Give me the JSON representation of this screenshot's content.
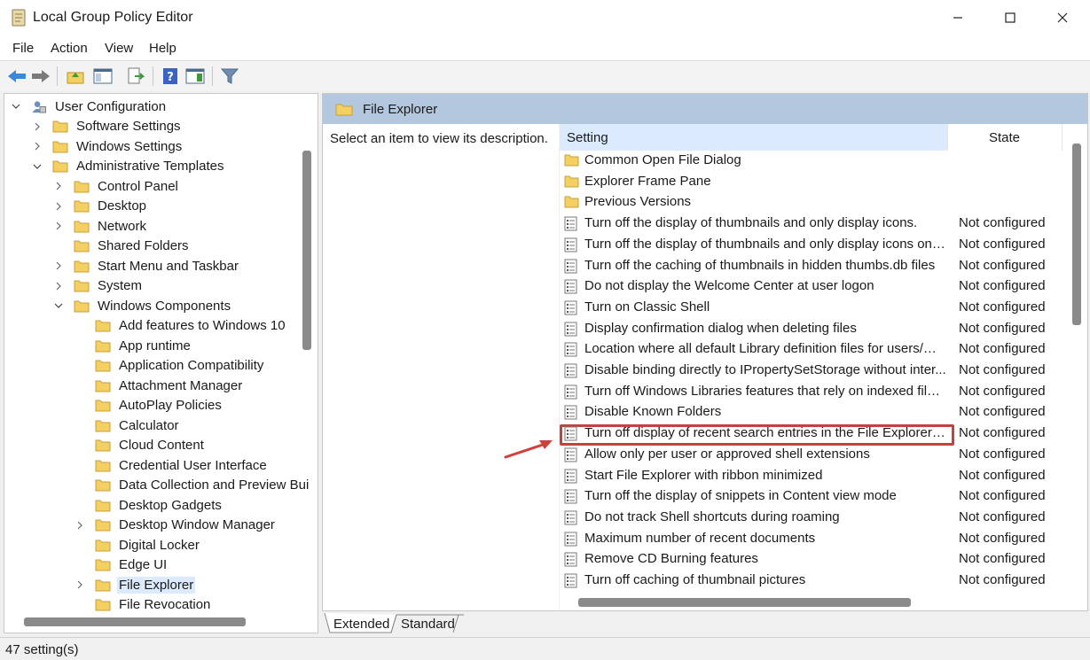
{
  "window": {
    "title": "Local Group Policy Editor"
  },
  "menu": [
    "File",
    "Action",
    "View",
    "Help"
  ],
  "toolbar": [
    "back-icon",
    "forward-icon",
    "up-folder-icon",
    "show-hide-tree-icon",
    "export-list-icon",
    "help-icon",
    "properties-icon",
    "filter-icon"
  ],
  "tree": [
    {
      "label": "User Configuration",
      "chevron": "down"
    },
    {
      "label": "Software Settings",
      "chevron": "right"
    },
    {
      "label": "Windows Settings",
      "chevron": "right"
    },
    {
      "label": "Administrative Templates",
      "chevron": "down"
    },
    {
      "label": "Control Panel",
      "chevron": "right"
    },
    {
      "label": "Desktop",
      "chevron": "right"
    },
    {
      "label": "Network",
      "chevron": "right"
    },
    {
      "label": "Shared Folders",
      "chevron": ""
    },
    {
      "label": "Start Menu and Taskbar",
      "chevron": "right"
    },
    {
      "label": "System",
      "chevron": "right"
    },
    {
      "label": "Windows Components",
      "chevron": "down"
    },
    {
      "label": "Add features to Windows 10",
      "chevron": ""
    },
    {
      "label": "App runtime",
      "chevron": ""
    },
    {
      "label": "Application Compatibility",
      "chevron": ""
    },
    {
      "label": "Attachment Manager",
      "chevron": ""
    },
    {
      "label": "AutoPlay Policies",
      "chevron": ""
    },
    {
      "label": "Calculator",
      "chevron": ""
    },
    {
      "label": "Cloud Content",
      "chevron": ""
    },
    {
      "label": "Credential User Interface",
      "chevron": ""
    },
    {
      "label": "Data Collection and Preview Bui",
      "chevron": ""
    },
    {
      "label": "Desktop Gadgets",
      "chevron": ""
    },
    {
      "label": "Desktop Window Manager",
      "chevron": "right"
    },
    {
      "label": "Digital Locker",
      "chevron": ""
    },
    {
      "label": "Edge UI",
      "chevron": ""
    },
    {
      "label": "File Explorer",
      "chevron": "right",
      "selected": true
    },
    {
      "label": "File Revocation",
      "chevron": ""
    }
  ],
  "details": {
    "header": "File Explorer",
    "description": "Select an item to view its description.",
    "columns": {
      "setting": "Setting",
      "state": "State"
    },
    "rows": [
      {
        "name": "Common Open File Dialog",
        "type": "folder",
        "state": ""
      },
      {
        "name": "Explorer Frame Pane",
        "type": "folder",
        "state": ""
      },
      {
        "name": "Previous Versions",
        "type": "folder",
        "state": ""
      },
      {
        "name": "Turn off the display of thumbnails and only display icons.",
        "type": "policy",
        "state": "Not configured"
      },
      {
        "name": "Turn off the display of thumbnails and only display icons on ...",
        "type": "policy",
        "state": "Not configured"
      },
      {
        "name": "Turn off the caching of thumbnails in hidden thumbs.db files",
        "type": "policy",
        "state": "Not configured"
      },
      {
        "name": "Do not display the Welcome Center at user logon",
        "type": "policy",
        "state": "Not configured"
      },
      {
        "name": "Turn on Classic Shell",
        "type": "policy",
        "state": "Not configured"
      },
      {
        "name": "Display confirmation dialog when deleting files",
        "type": "policy",
        "state": "Not configured"
      },
      {
        "name": "Location where all default Library definition files for users/ma...",
        "type": "policy",
        "state": "Not configured"
      },
      {
        "name": "Disable binding directly to IPropertySetStorage without inter...",
        "type": "policy",
        "state": "Not configured"
      },
      {
        "name": "Turn off Windows Libraries features that rely on indexed file ...",
        "type": "policy",
        "state": "Not configured"
      },
      {
        "name": "Disable Known Folders",
        "type": "policy",
        "state": "Not configured"
      },
      {
        "name": "Turn off display of recent search entries in the File Explorer se...",
        "type": "policy",
        "state": "Not configured",
        "highlighted": true
      },
      {
        "name": "Allow only per user or approved shell extensions",
        "type": "policy",
        "state": "Not configured"
      },
      {
        "name": "Start File Explorer with ribbon minimized",
        "type": "policy",
        "state": "Not configured"
      },
      {
        "name": "Turn off the display of snippets in Content view mode",
        "type": "policy",
        "state": "Not configured"
      },
      {
        "name": "Do not track Shell shortcuts during roaming",
        "type": "policy",
        "state": "Not configured"
      },
      {
        "name": "Maximum number of recent documents",
        "type": "policy",
        "state": "Not configured"
      },
      {
        "name": "Remove CD Burning features",
        "type": "policy",
        "state": "Not configured"
      },
      {
        "name": "Turn off caching of thumbnail pictures",
        "type": "policy",
        "state": "Not configured"
      }
    ]
  },
  "tabs": [
    "Extended",
    "Standard"
  ],
  "status": "47 setting(s)",
  "colors": {
    "header_band": "#b3c7de",
    "selection": "#dbeafd",
    "highlight_box": "#c0443b",
    "folder": "#f4cf62"
  }
}
